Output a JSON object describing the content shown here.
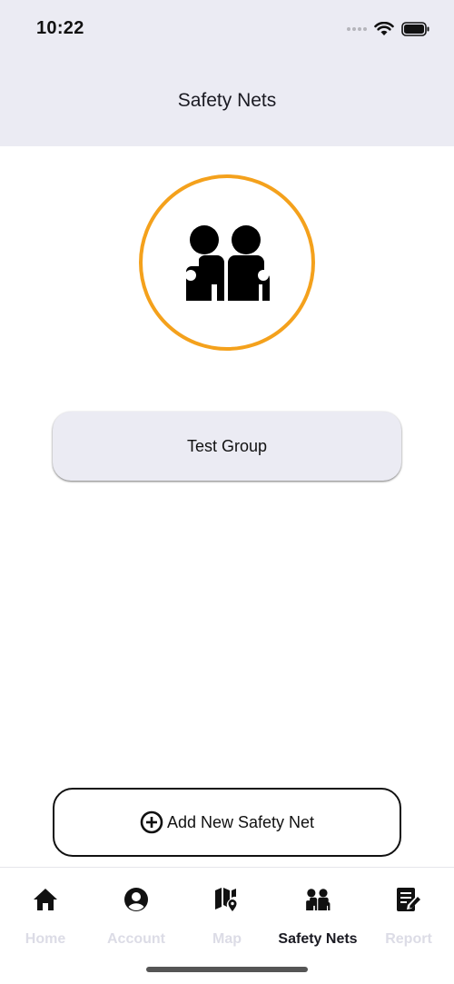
{
  "status_bar": {
    "time": "10:22"
  },
  "header": {
    "title": "Safety Nets"
  },
  "groups": [
    {
      "name": "Test Group"
    }
  ],
  "add_button": {
    "label": "Add New Safety Net"
  },
  "tabs": [
    {
      "label": "Home",
      "icon": "home-icon",
      "active": false
    },
    {
      "label": "Account",
      "icon": "account-icon",
      "active": false
    },
    {
      "label": "Map",
      "icon": "map-icon",
      "active": false
    },
    {
      "label": "Safety Nets",
      "icon": "safety-nets-icon",
      "active": true
    },
    {
      "label": "Report",
      "icon": "report-icon",
      "active": false
    }
  ],
  "colors": {
    "accent_ring": "#f4a11c",
    "header_bg": "#ebebf3",
    "inactive_tab": "#dcdce6"
  }
}
